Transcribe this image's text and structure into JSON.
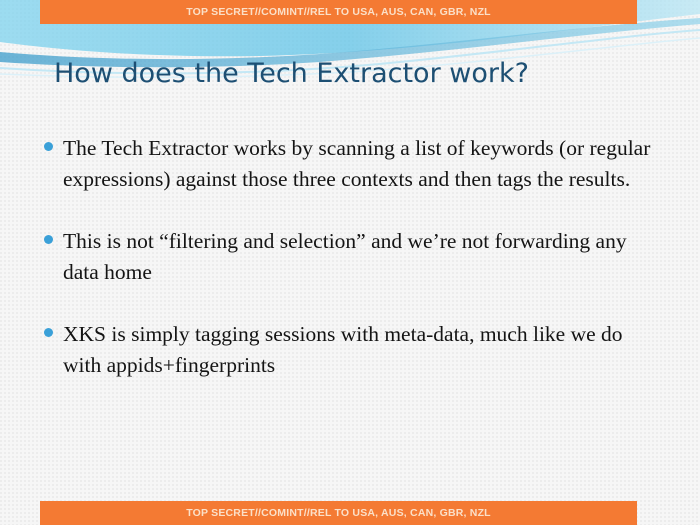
{
  "classification_top": "TOP SECRET//COMINT//REL TO USA, AUS, CAN, GBR, NZL",
  "classification_bottom": "TOP SECRET//COMINT//REL TO USA, AUS, CAN, GBR, NZL",
  "title": "How does the Tech Extractor work?",
  "bullets": [
    {
      "text": "The Tech Extractor works by scanning a list of keywords (or regular expressions) against those three contexts and then tags the results."
    },
    {
      "text": "This is not “filtering and selection” and we’re not forwarding any data home"
    },
    {
      "text": "XKS is simply tagging sessions with meta-data, much like we do with appids+fingerprints"
    }
  ],
  "colors": {
    "banner": "#f47a33",
    "title": "#1d4f73",
    "bullet_marker": "#3aa0d8"
  }
}
